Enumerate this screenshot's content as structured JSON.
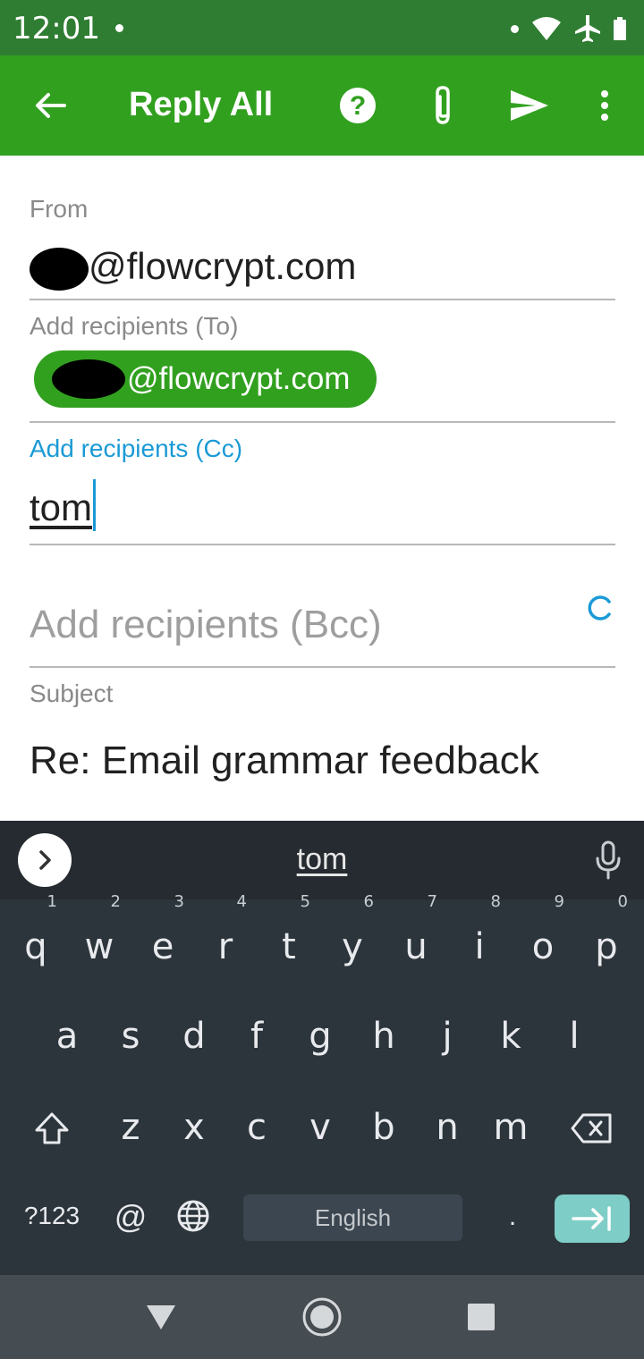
{
  "status_bar": {
    "time": "12:01"
  },
  "app_bar": {
    "title": "Reply All",
    "back_icon": "arrow-back-icon",
    "help_icon": "help-icon",
    "attach_icon": "paperclip-icon",
    "send_icon": "send-icon",
    "menu_icon": "more-vert-icon",
    "color": "#31a01f"
  },
  "form": {
    "from_label": "From",
    "from_value": "@flowcrypt.com",
    "to_label": "Add recipients (To)",
    "to_chip": "@flowcrypt.com",
    "cc_label": "Add recipients (Cc)",
    "cc_value": "tom",
    "bcc_placeholder": "Add recipients (Bcc)",
    "subject_label": "Subject",
    "subject_value": "Re: Email grammar feedback",
    "accent_color": "#1a9ad6"
  },
  "keyboard": {
    "suggestion": "tom",
    "row1": [
      {
        "k": "q",
        "h": "1"
      },
      {
        "k": "w",
        "h": "2"
      },
      {
        "k": "e",
        "h": "3"
      },
      {
        "k": "r",
        "h": "4"
      },
      {
        "k": "t",
        "h": "5"
      },
      {
        "k": "y",
        "h": "6"
      },
      {
        "k": "u",
        "h": "7"
      },
      {
        "k": "i",
        "h": "8"
      },
      {
        "k": "o",
        "h": "9"
      },
      {
        "k": "p",
        "h": "0"
      }
    ],
    "row2": [
      "a",
      "s",
      "d",
      "f",
      "g",
      "h",
      "j",
      "k",
      "l"
    ],
    "row3": [
      "z",
      "x",
      "c",
      "v",
      "b",
      "n",
      "m"
    ],
    "symbols_key": "?123",
    "at_key": "@",
    "space_label": "English",
    "period_key": "."
  }
}
